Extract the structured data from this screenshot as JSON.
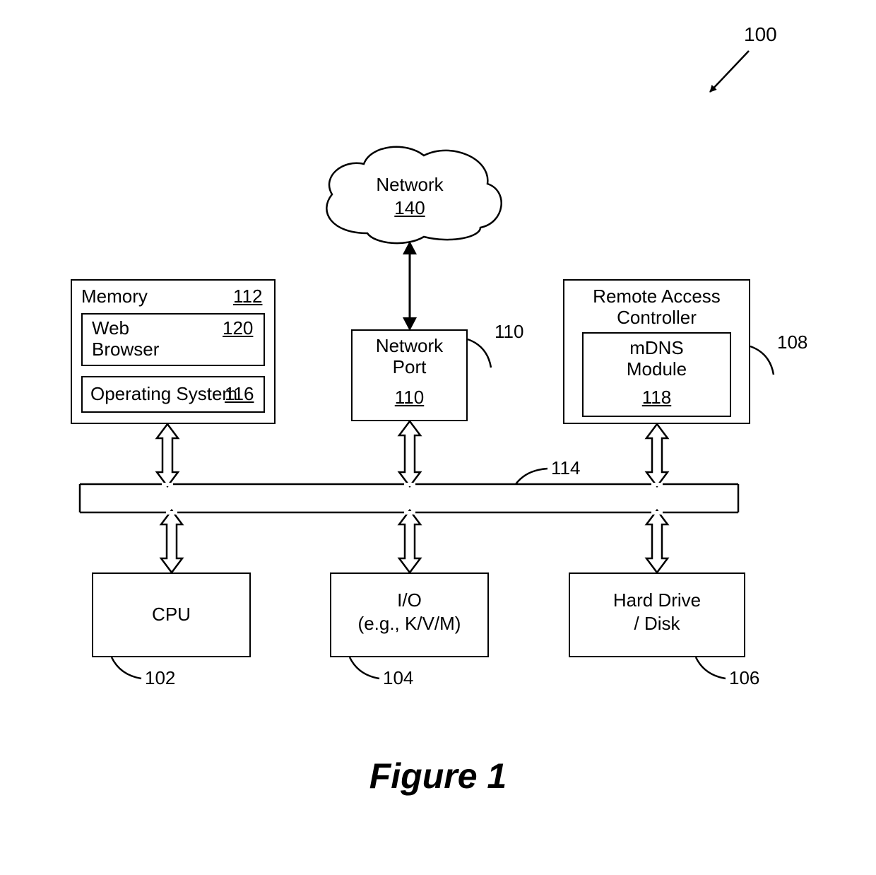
{
  "figure": {
    "title": "Figure 1",
    "overall_ref": "100"
  },
  "network": {
    "label": "Network",
    "ref": "140"
  },
  "network_port": {
    "label1": "Network",
    "label2": "Port",
    "ref": "110",
    "leader_ref": "110"
  },
  "memory": {
    "label": "Memory",
    "ref": "112",
    "web_browser": {
      "label1": "Web",
      "label2": "Browser",
      "ref": "120"
    },
    "os": {
      "label": "Operating System",
      "ref": "116"
    }
  },
  "rac": {
    "label1": "Remote Access",
    "label2": "Controller",
    "leader_ref": "108",
    "mdns": {
      "label1": "mDNS",
      "label2": "Module",
      "ref": "118"
    }
  },
  "cpu": {
    "label": "CPU",
    "leader_ref": "102"
  },
  "io": {
    "label1": "I/O",
    "label2": "(e.g., K/V/M)",
    "leader_ref": "104"
  },
  "hdd": {
    "label1": "Hard Drive",
    "label2": "/ Disk",
    "leader_ref": "106"
  },
  "bus": {
    "leader_ref": "114"
  }
}
